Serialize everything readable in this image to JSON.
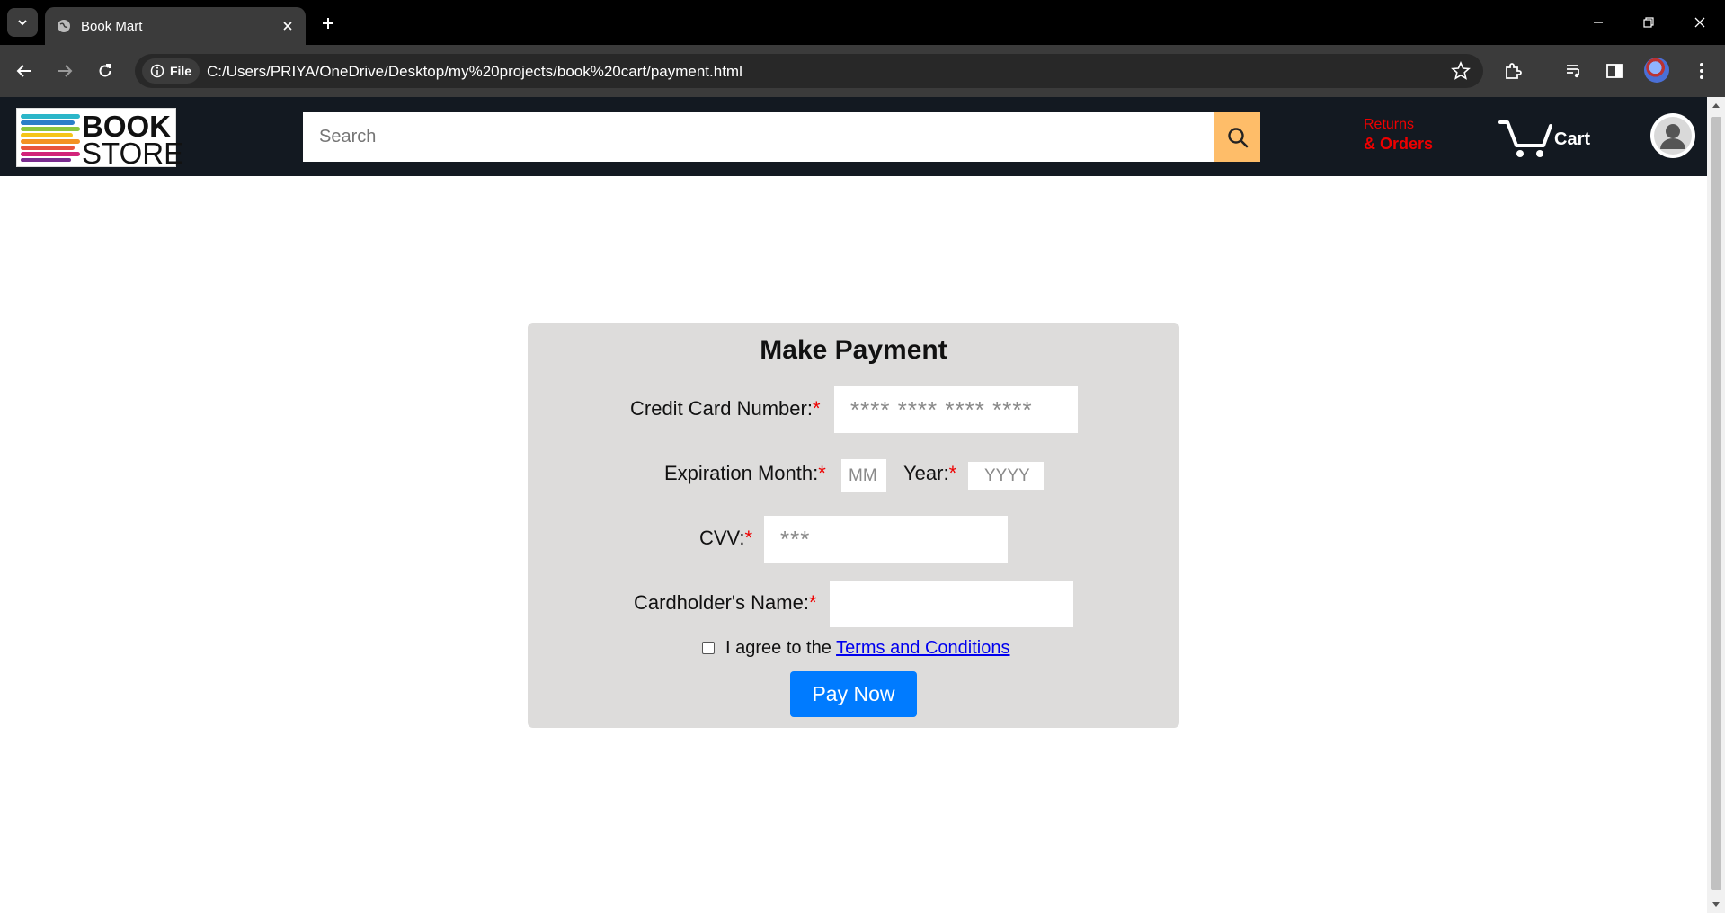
{
  "browser": {
    "tab_title": "Book Mart",
    "file_chip": "File",
    "url": "C:/Users/PRIYA/OneDrive/Desktop/my%20projects/book%20cart/payment.html"
  },
  "header": {
    "logo_top": "BOOK",
    "logo_bottom": "STORE",
    "search_placeholder": "Search",
    "returns_top": "Returns",
    "returns_bottom": "& Orders",
    "cart_label": "Cart"
  },
  "payment": {
    "title": "Make Payment",
    "card_number_label": "Credit Card Number:",
    "card_number_placeholder": "**** **** **** ****",
    "exp_month_label": "Expiration Month:",
    "exp_month_placeholder": "MM",
    "exp_year_label": "Year:",
    "exp_year_placeholder": "YYYY",
    "cvv_label": "CVV:",
    "cvv_placeholder": "***",
    "name_label": "Cardholder's Name:",
    "required_mark": "*",
    "agree_text": "I agree to the ",
    "terms_link": "Terms and Conditions",
    "pay_button": "Pay Now"
  },
  "colors": {
    "header_bg": "#131921",
    "search_button": "#febd69",
    "returns_text": "#e00000",
    "card_bg": "#dddcdb",
    "pay_button": "#007bff",
    "required": "#e00000"
  }
}
